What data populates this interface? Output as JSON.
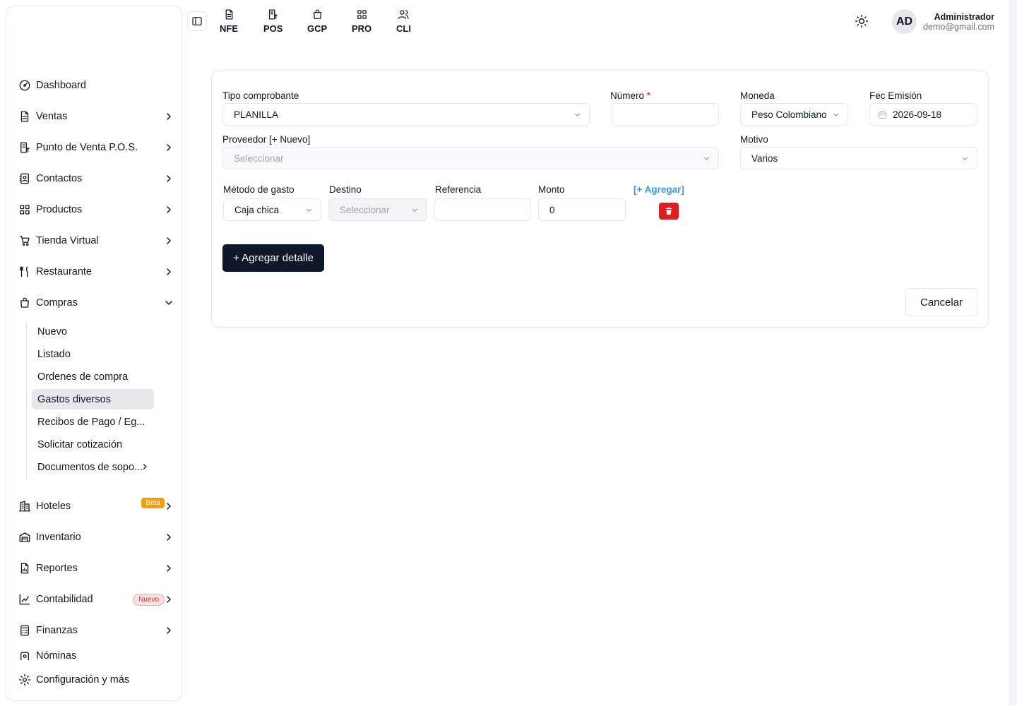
{
  "sidebar": {
    "items": [
      {
        "label": "Dashboard",
        "icon": "gauge-icon"
      },
      {
        "label": "Ventas",
        "icon": "document-icon"
      },
      {
        "label": "Punto de Venta P.O.S.",
        "icon": "pos-icon"
      },
      {
        "label": "Contactos",
        "icon": "contacts-icon"
      },
      {
        "label": "Productos",
        "icon": "grid-icon"
      },
      {
        "label": "Tienda Virtual",
        "icon": "cart-icon"
      },
      {
        "label": "Restaurante",
        "icon": "utensils-icon"
      },
      {
        "label": "Compras",
        "icon": "shopping-bag-icon"
      }
    ],
    "compras_sub": [
      "Nuevo",
      "Listado",
      "Ordenes de compra",
      "Gastos diversos",
      "Recibos de Pago / Eg...",
      "Solicitar cotización",
      "Documentos de sopo..."
    ],
    "items_bottom": [
      {
        "label": "Hoteles",
        "icon": "building-icon",
        "badge": "Beta"
      },
      {
        "label": "Inventario",
        "icon": "warehouse-icon"
      },
      {
        "label": "Reportes",
        "icon": "report-icon"
      },
      {
        "label": "Contabilidad",
        "icon": "chart-icon",
        "badge": "Nuevo"
      },
      {
        "label": "Finanzas",
        "icon": "calculator-icon"
      },
      {
        "label": "Nóminas",
        "icon": "payroll-icon"
      }
    ],
    "config_label": "Configuración y más"
  },
  "topbar": {
    "quick": [
      "NFE",
      "POS",
      "GCP",
      "PRO",
      "CLI"
    ],
    "user_initials": "AD",
    "user_name": "Administrador",
    "user_email": "demo@gmail.com"
  },
  "form": {
    "tipo_label": "Tipo comprobante",
    "tipo_value": "PLANILLA",
    "numero_label": "Número",
    "numero_required": "*",
    "numero_value": "",
    "moneda_label": "Moneda",
    "moneda_value": "Peso Colombiano",
    "fecha_label": "Fec Emisión",
    "fecha_value": "2026-09-18",
    "proveedor_label": "Proveedor [+ Nuevo]",
    "proveedor_placeholder": "Seleccionar",
    "motivo_label": "Motivo",
    "motivo_value": "Varios",
    "metodo_label": "Método de gasto",
    "metodo_value": "Caja chica",
    "destino_label": "Destino",
    "destino_placeholder": "Seleccionar",
    "referencia_label": "Referencia",
    "referencia_value": "",
    "monto_label": "Monto",
    "monto_value": "0",
    "agregar_link": "[+ Agregar]",
    "add_detail_button": "+ Agregar detalle",
    "cancel_button": "Cancelar"
  },
  "colors": {
    "primary": "#0f172a",
    "danger": "#e11d1d",
    "link": "#3b9ae8",
    "badge_beta": "#f59e0b"
  }
}
